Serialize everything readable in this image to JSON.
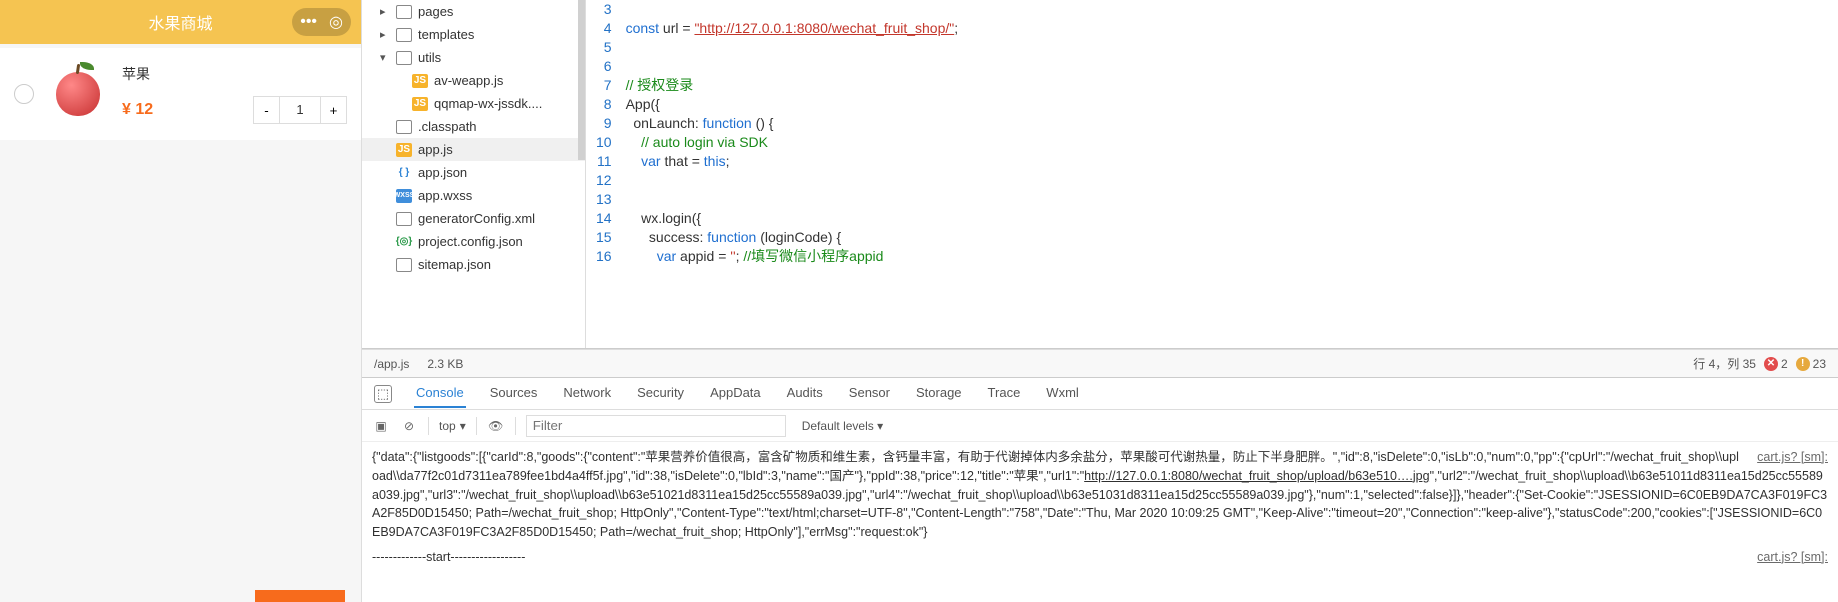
{
  "simulator": {
    "title": "水果商城",
    "item": {
      "name": "苹果",
      "price": "¥ 12",
      "qty": "1",
      "minus": "-",
      "plus": "+"
    }
  },
  "tree": {
    "items": [
      {
        "level": 1,
        "caret": "▸",
        "icon": "folder",
        "label": "pages"
      },
      {
        "level": 1,
        "caret": "▸",
        "icon": "folder",
        "label": "templates"
      },
      {
        "level": 1,
        "caret": "▾",
        "icon": "folder",
        "label": "utils"
      },
      {
        "level": 2,
        "caret": "",
        "icon": "js",
        "label": "av-weapp.js"
      },
      {
        "level": 2,
        "caret": "",
        "icon": "js",
        "label": "qqmap-wx-jssdk...."
      },
      {
        "level": 1,
        "caret": "",
        "icon": "file",
        "label": ".classpath"
      },
      {
        "level": 1,
        "caret": "",
        "icon": "js",
        "label": "app.js",
        "selected": true
      },
      {
        "level": 1,
        "caret": "",
        "icon": "json",
        "label": "app.json"
      },
      {
        "level": 1,
        "caret": "",
        "icon": "wxss",
        "label": "app.wxss"
      },
      {
        "level": 1,
        "caret": "",
        "icon": "file",
        "label": "generatorConfig.xml"
      },
      {
        "level": 1,
        "caret": "",
        "icon": "target",
        "label": "project.config.json"
      },
      {
        "level": 1,
        "caret": "",
        "icon": "file",
        "label": "sitemap.json"
      }
    ]
  },
  "editor": {
    "line_start": 3,
    "lines": [
      {
        "n": 3,
        "html": ""
      },
      {
        "n": 4,
        "html": "<span class='kw'>const</span> url = <span class='str'>\"http://127.0.0.1:8080/wechat_fruit_shop/\"</span>;"
      },
      {
        "n": 5,
        "html": ""
      },
      {
        "n": 6,
        "html": ""
      },
      {
        "n": 7,
        "html": "<span class='com'>// 授权登录</span>"
      },
      {
        "n": 8,
        "html": "App({"
      },
      {
        "n": 9,
        "html": "  onLaunch: <span class='kw'>function</span> () {"
      },
      {
        "n": 10,
        "html": "    <span class='com'>// auto login via SDK</span>"
      },
      {
        "n": 11,
        "html": "    <span class='kw'>var</span> that = <span class='kw'>this</span>;"
      },
      {
        "n": 12,
        "html": ""
      },
      {
        "n": 13,
        "html": ""
      },
      {
        "n": 14,
        "html": "    wx.login({"
      },
      {
        "n": 15,
        "html": "      success: <span class='kw'>function</span> (loginCode) {"
      },
      {
        "n": 16,
        "html": "        <span class='kw'>var</span> appid = <span class='str2'>''</span>; <span class='com'>//填写微信小程序appid</span>"
      }
    ],
    "status_path": "/app.js",
    "status_size": "2.3 KB",
    "status_pos": "行 4，列 35"
  },
  "devtools": {
    "tabs": [
      "Console",
      "Sources",
      "Network",
      "Security",
      "AppData",
      "Audits",
      "Sensor",
      "Storage",
      "Trace",
      "Wxml"
    ],
    "active_tab": "Console",
    "ctx": "top",
    "filter_placeholder": "Filter",
    "levels": "Default levels ▾",
    "errors": "2",
    "warnings": "23",
    "console": {
      "line1_src": "cart.js? [sm]:",
      "body_text": "{\"data\":{\"listgoods\":[{\"carId\":8,\"goods\":{\"content\":\"苹果营养价值很高，富含矿物质和维生素，含钙量丰富，有助于代谢掉体内多余盐分，苹果酸可代谢热量，防止下半身肥胖。\",\"id\":8,\"isDelete\":0,\"isLb\":0,\"num\":0,\"pp\":{\"cpUrl\":\"/wechat_fruit_shop\\\\upload\\\\da77f2c01d7311ea789fee1bd4a4ff5f.jpg\",\"id\":38,\"isDelete\":0,\"lbId\":3,\"name\":\"国产\"},\"ppId\":38,\"price\":12,\"title\":\"苹果\",\"url1\":\"http://127.0.0.1:8080/wechat_fruit_shop/upload/b63e510….jpg\",\"url2\":\"/wechat_fruit_shop\\\\upload\\\\b63e51011d8311ea15d25cc55589a039.jpg\",\"url3\":\"/wechat_fruit_shop\\\\upload\\\\b63e51021d8311ea15d25cc55589a039.jpg\",\"url4\":\"/wechat_fruit_shop\\\\upload\\\\b63e51031d8311ea15d25cc55589a039.jpg\"},\"num\":1,\"selected\":false}]},\"header\":{\"Set-Cookie\":\"JSESSIONID=6C0EB9DA7CA3F019FC3A2F85D0D15450; Path=/wechat_fruit_shop; HttpOnly\",\"Content-Type\":\"text/html;charset=UTF-8\",\"Content-Length\":\"758\",\"Date\":\"Thu, Mar 2020 10:09:25 GMT\",\"Keep-Alive\":\"timeout=20\",\"Connection\":\"keep-alive\"},\"statusCode\":200,\"cookies\":[\"JSESSIONID=6C0EB9DA7CA3F019FC3A2F85D0D15450; Path=/wechat_fruit_shop; HttpOnly\"],\"errMsg\":\"request:ok\"}",
      "line2_src": "cart.js? [sm]:",
      "line2_text": "-------------start------------------"
    }
  }
}
